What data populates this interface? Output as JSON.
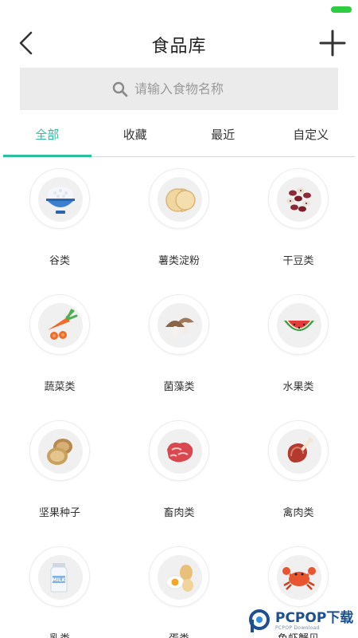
{
  "header": {
    "title": "食品库",
    "back_icon": "chevron-left-icon",
    "add_icon": "plus-icon"
  },
  "search": {
    "placeholder": "请输入食物名称",
    "icon": "search-icon"
  },
  "tabs": [
    {
      "label": "全部",
      "active": true
    },
    {
      "label": "收藏",
      "active": false
    },
    {
      "label": "最近",
      "active": false
    },
    {
      "label": "自定义",
      "active": false
    }
  ],
  "categories": [
    {
      "label": "谷类",
      "icon": "rice-bowl-icon"
    },
    {
      "label": "薯类淀粉",
      "icon": "potato-slices-icon"
    },
    {
      "label": "干豆类",
      "icon": "beans-icon"
    },
    {
      "label": "蔬菜类",
      "icon": "carrot-icon"
    },
    {
      "label": "菌藻类",
      "icon": "mushroom-icon"
    },
    {
      "label": "水果类",
      "icon": "watermelon-icon"
    },
    {
      "label": "坚果种子",
      "icon": "nuts-icon"
    },
    {
      "label": "畜肉类",
      "icon": "meat-icon"
    },
    {
      "label": "禽肉类",
      "icon": "poultry-leg-icon"
    },
    {
      "label": "乳类",
      "icon": "milk-icon"
    },
    {
      "label": "蛋类",
      "icon": "eggs-icon"
    },
    {
      "label": "鱼虾蟹贝",
      "icon": "crab-icon"
    }
  ],
  "watermark": {
    "main": "PCPOP下载",
    "sub": "PCPOP Download"
  },
  "colors": {
    "accent": "#2bbf9e",
    "search_bg": "#ebebeb",
    "battery": "#2ecc40"
  }
}
